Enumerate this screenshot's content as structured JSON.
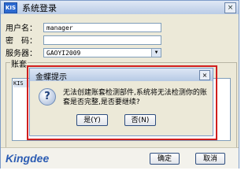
{
  "window": {
    "app_badge": "KIS",
    "title": "系统登录",
    "close_glyph": "×"
  },
  "form": {
    "username_label": "用户名：",
    "username_value": "manager",
    "password_label": "密　码：",
    "password_value": "",
    "server_label": "服务器：",
    "server_value": "GAOYI2009",
    "server_dropdown_glyph": "▼"
  },
  "account_set": {
    "group_label": "账套",
    "items": [
      "KIS"
    ]
  },
  "footer": {
    "logo_text": "Kingdee",
    "ok_label": "确定",
    "cancel_label": "取消"
  },
  "dialog": {
    "title": "金蝶提示",
    "close_glyph": "×",
    "icon_glyph": "?",
    "message": "无法创建账套检测部件,系统将无法检测你的账套是否完整,是否要继续?",
    "yes_label": "是(Y)",
    "no_label": "否(N)",
    "highlight_color": "#d01e1e"
  }
}
